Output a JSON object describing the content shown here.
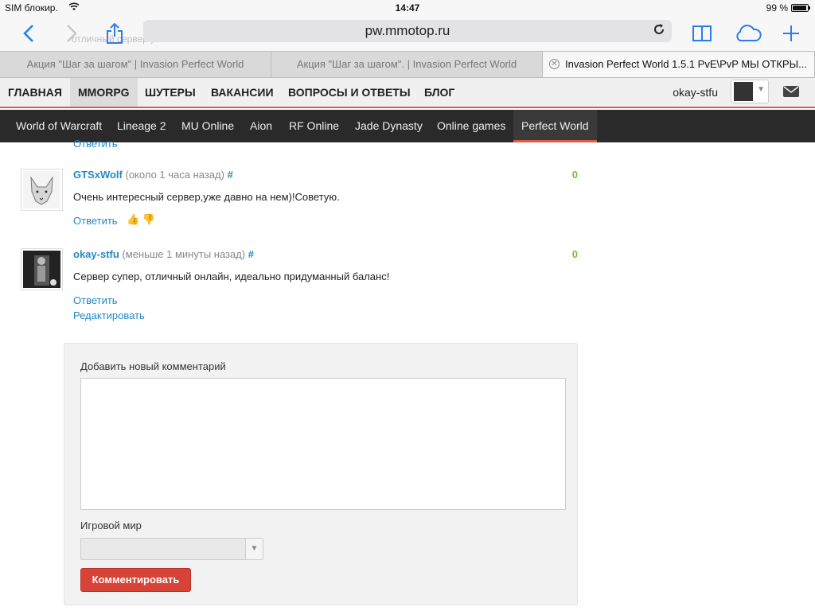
{
  "status_bar": {
    "carrier": "SIM блокир.",
    "time": "14:47",
    "battery": "99 %"
  },
  "browser": {
    "url": "pw.mmotop.ru",
    "ghost_text": "отличный сервер!)",
    "tabs": [
      "Акция \"Шаг за шагом\" | Invasion Perfect World",
      "Акция \"Шаг за шагом\". | Invasion Perfect World",
      "Invasion Perfect World 1.5.1 PvE\\PvP МЫ ОТКРЫ..."
    ],
    "close_tab": "✕",
    "icons": [
      "back-icon",
      "forward-icon",
      "share-icon",
      "reload-icon",
      "bookmarks-icon",
      "cloud-icon",
      "new-tab-icon"
    ]
  },
  "main_nav": {
    "items": [
      "ГЛАВНАЯ",
      "MMORPG",
      "ШУТЕРЫ",
      "ВАКАНСИИ",
      "ВОПРОСЫ И ОТВЕТЫ",
      "БЛОГ"
    ],
    "active_index": 1,
    "username": "okay-stfu"
  },
  "sub_nav": {
    "items": [
      "World of Warcraft",
      "Lineage 2",
      "MU Online",
      "Aion",
      "RF Online",
      "Jade Dynasty",
      "Online games",
      "Perfect World"
    ],
    "active_index": 7
  },
  "comments": {
    "cut_reply": "Ответить",
    "list": [
      {
        "author": "GTSxWolf",
        "meta": "(около 1 часа назад)",
        "hash": "#",
        "score": "0",
        "text": "Очень интересный сервер,уже давно на нем)!Советую.",
        "reply": "Ответить"
      },
      {
        "author": "okay-stfu",
        "meta": "(меньше 1 минуты назад)",
        "hash": "#",
        "score": "0",
        "text": "Сервер супер, отличный онлайн, идеально придуманный баланс!",
        "reply": "Ответить",
        "edit": "Редактировать"
      }
    ]
  },
  "form": {
    "title": "Добавить новый комментарий",
    "textarea_value": "",
    "world_label": "Игровой мир",
    "world_value": "",
    "submit": "Комментировать"
  },
  "colors": {
    "accent": "#e05a45",
    "link": "#2389c6",
    "score": "#6bc43c",
    "submit": "#d74337",
    "ios_blue": "#2b7bf2"
  }
}
